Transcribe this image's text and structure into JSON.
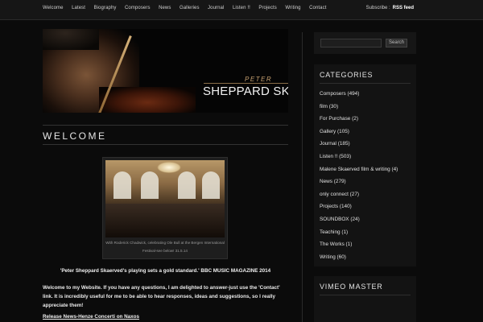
{
  "nav": {
    "items": [
      "Welcome",
      "Latest",
      "Biography",
      "Composers",
      "News",
      "Galleries",
      "Journal",
      "Listen !!",
      "Projects",
      "Writing",
      "Contact"
    ],
    "subscribe_label": "Subscribe :",
    "rss_label": "RSS feed"
  },
  "header": {
    "first_name": "PETER",
    "full_name": "SHEPPARD SKÆRVED"
  },
  "main": {
    "title": "WELCOME",
    "photo_caption": "With Roderick Chadwick, celebrating Ole Bull at the Bergen International Festival-see below! 31.5.14",
    "quote": "'Peter Sheppard Skaerved's playing sets a gold standard.' BBC MUSIC MAGAZINE 2014",
    "intro": "Welcome to my Website. If you have any questions, I am delighted to answer-just use the 'Contact' link. It is incredibly useful for me to be able to hear responses, ideas and suggestions, so I really appreciate them!",
    "release_link": "Release News-Henze Concerti on Naxos"
  },
  "sidebar": {
    "search": {
      "button_label": "Search",
      "value": ""
    },
    "categories_title": "CATEGORIES",
    "categories": [
      "Composers (494)",
      "film (30)",
      "For Purchase (2)",
      "Gallery (105)",
      "Journal (185)",
      "Listen !! (503)",
      "Malene Skaerved film & writing (4)",
      "News (279)",
      "only connect (27)",
      "Projects (140)",
      "SOUNDBOX (24)",
      "Teaching (1)",
      "The Works (1)",
      "Writing (60)"
    ],
    "vimeo_title": "VIMEO MASTER"
  }
}
